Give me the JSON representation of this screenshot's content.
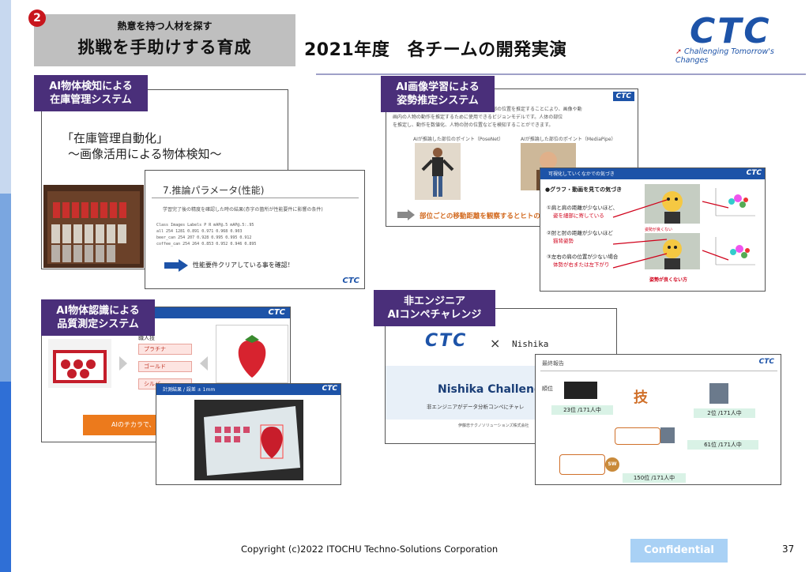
{
  "header": {
    "badge": "2",
    "subtitle": "熱意を持つ人材を探す",
    "title": "挑戦を手助けする育成",
    "heading": "2021年度　各チームの開発実演"
  },
  "logo": {
    "text": "CTC",
    "tagline": "Challenging Tomorrow's Changes"
  },
  "panels": {
    "p1": {
      "label1": "AI物体検知による",
      "label2": "在庫管理システム",
      "slide_title_1": "「在庫管理自動化」",
      "slide_title_2": "～画像活用による物体検知～",
      "sub_title": "7.推論パラメータ(性能)",
      "sub_note": "学習完了後の精度を確認した時の結果(赤字の箇所が性能要件に影響の条件)",
      "sub_row1": "Class   Images  Labels   P      R     mAP@.5  mAP@.5:.95",
      "sub_row2": "all       254    1281   0.891  0.971   0.968    0.903",
      "sub_row3": "beer_can  254     207   0.928  0.995   0.995    0.912",
      "sub_row4": "coffee_can 254    264   0.853  0.952   0.946    0.895",
      "sub_result": "性能要件クリアしている事を確認！",
      "ctc": "CTC"
    },
    "p2": {
      "label1": "AI画像学習による",
      "label2": "姿勢推定システム",
      "text1": "部の位置を推定することにより、画像や動",
      "text2": "画内の人物の動作を推定するために使用できるビジョンモデルです。人体の部位",
      "text3": "を推定し、動作を数値化、人物の肘の位置などを検知することができます。",
      "cap_a": "AIが推論した部位のポイント（PoseNet）",
      "cap_b": "AIが推論した部位のポイント（MediaPipe）",
      "bottom": "部位ごとの移動距離を観察するとヒトの動",
      "sub_header": "可視化していくなかでの気づき",
      "sub_title": "●グラフ・動画を見ての気づき",
      "item1a": "①肩と肩の距離が少ないほど、",
      "item1b": "姿を細部に寄している",
      "item2a": "②肘と肘の距離が少ないほど",
      "item2b": "猫背姿勢",
      "item3a": "③左右の肩の位置が少ない場合",
      "item3b": "体勢が右または左下がり",
      "note1": "姿勢が良くない",
      "note2": "姿勢が良くない方",
      "ctc": "CTC"
    },
    "p3": {
      "label1": "AI物体認識による",
      "label2": "品質測定システム",
      "btn1": "職人技",
      "btn2": "プラチナ",
      "btn3": "ゴールド",
      "btn4": "シルバー",
      "orange": "AIのチカラで、ひ",
      "sub_header": "計測結果 / 誤差 ± 1mm",
      "ctc": "CTC"
    },
    "p4": {
      "label1": "非エンジニア",
      "label2": "AIコンペチャレンジ",
      "cross": "×",
      "partner": "Nishika",
      "challenge": "Nishika Challenge",
      "challenge_sub": "非エンジニアがデータ分析コンペにチャレ",
      "company": "伊藤忠テクノソリューションズ株式会社",
      "sub_header": "最終報告",
      "rank_label": "順位",
      "rank1": "23位 /171人中",
      "rank2": "2位 /171人中",
      "rank3": "61位 /171人中",
      "rank4": "150位 /171人中",
      "gi": "技",
      "sw": "SW",
      "ctc": "CTC"
    }
  },
  "footer": {
    "copyright": "Copyright (c)2022 ITOCHU Techno-Solutions Corporation",
    "confidential": "Confidential",
    "page": "37"
  },
  "colors": {
    "ctc_blue": "#1d53a8",
    "label_purple": "#4a2f7a",
    "badge_red": "#c8161d"
  }
}
